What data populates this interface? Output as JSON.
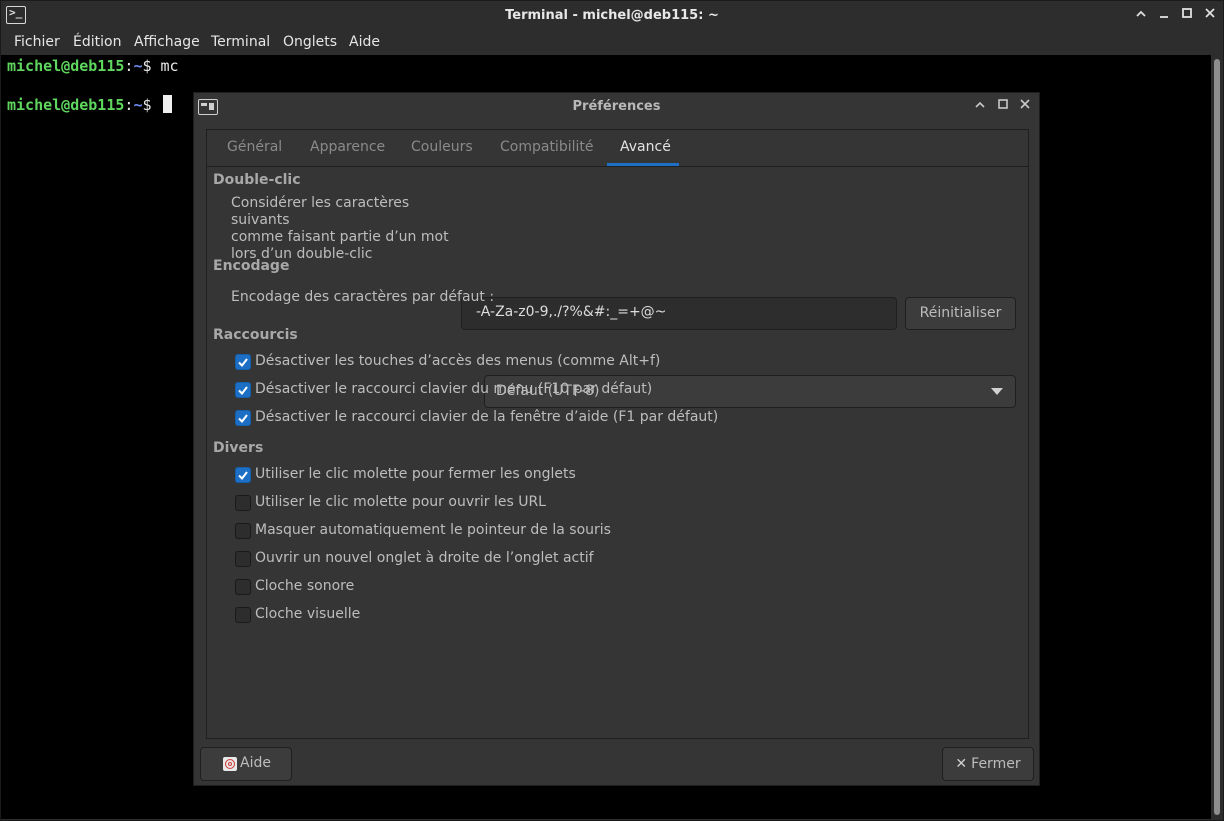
{
  "terminal": {
    "title": "Terminal - michel@deb115: ~",
    "menu": [
      "Fichier",
      "Édition",
      "Affichage",
      "Terminal",
      "Onglets",
      "Aide"
    ],
    "lines": [
      {
        "user": "michel@deb115",
        "sep": ":",
        "path": "~",
        "prompt": "$ ",
        "cmd": "mc"
      },
      {
        "user": "michel@deb115",
        "sep": ":",
        "path": "~",
        "prompt": "$ ",
        "cmd": ""
      }
    ],
    "colors": {
      "user": "#5fd75f",
      "path": "#6f8df0",
      "background": "#000000"
    }
  },
  "prefs": {
    "title": "Préférences",
    "tabs": [
      "Général",
      "Apparence",
      "Couleurs",
      "Compatibilité",
      "Avancé"
    ],
    "active_tab": "Avancé",
    "double_click": {
      "heading": "Double-clic",
      "label_lines": [
        "Considérer les caractères suivants",
        "comme faisant partie d’un mot",
        "lors d’un double-clic"
      ],
      "value": "-A-Za-z0-9,./?%&#:_=+@~",
      "reset_label": "Réinitialiser"
    },
    "encoding": {
      "heading": "Encodage",
      "label": "Encodage des caractères par défaut :",
      "selected": "Défaut (UTF-8)"
    },
    "shortcuts": {
      "heading": "Raccourcis",
      "items": [
        {
          "label": "Désactiver les touches d’accès des menus (comme Alt+f)",
          "checked": true
        },
        {
          "label": "Désactiver le raccourci clavier du menu (F10 par défaut)",
          "checked": true
        },
        {
          "label": "Désactiver le raccourci clavier de la fenêtre d’aide (F1 par défaut)",
          "checked": true
        }
      ]
    },
    "misc": {
      "heading": "Divers",
      "items": [
        {
          "label": "Utiliser le clic molette pour fermer les onglets",
          "checked": true
        },
        {
          "label": "Utiliser le clic molette pour ouvrir les URL",
          "checked": false
        },
        {
          "label": "Masquer automatiquement le pointeur de la souris",
          "checked": false
        },
        {
          "label": "Ouvrir un nouvel onglet à droite de l’onglet actif",
          "checked": false
        },
        {
          "label": "Cloche sonore",
          "checked": false
        },
        {
          "label": "Cloche visuelle",
          "checked": false
        }
      ]
    },
    "help_label": "Aide",
    "close_label": "Fermer",
    "accent": "#1c6fc5"
  }
}
